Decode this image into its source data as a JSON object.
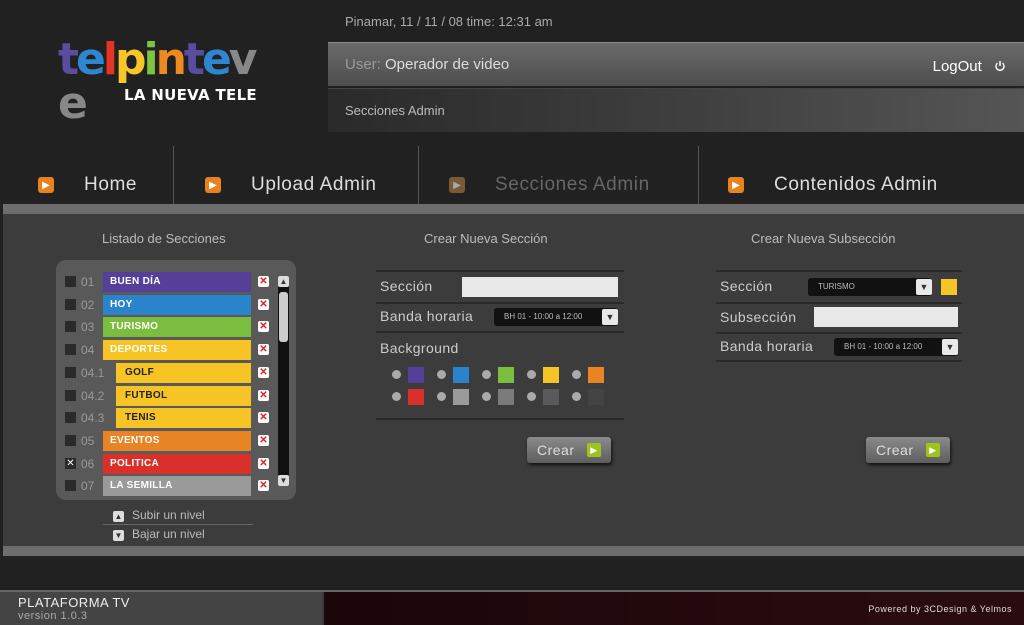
{
  "logo": {
    "word": [
      "t",
      "e",
      "l",
      "p",
      "i",
      "n",
      "t",
      "e",
      "v",
      "e"
    ],
    "colors": [
      "#5a4da0",
      "#2e86d1",
      "#e53422",
      "#f7c628",
      "#7ec342",
      "#ec8b1f",
      "#5a4da0",
      "#2e86d1",
      "#888",
      "#888"
    ],
    "tagline": "LA NUEVA TELE"
  },
  "header": {
    "date_time": "Pinamar, 11 / 11 / 08   time: 12:31 am",
    "user_label": "User:",
    "user_name": "Operador de video",
    "logout": "LogOut",
    "section": "Secciones Admin"
  },
  "nav": [
    {
      "label": "Home",
      "icon": "arrow-right-icon"
    },
    {
      "label": "Upload Admin",
      "icon": "arrow-right-icon"
    },
    {
      "label": "Secciones Admin",
      "icon": "arrow-right-icon",
      "disabled": true
    },
    {
      "label": "Contenidos Admin",
      "icon": "arrow-right-icon"
    }
  ],
  "list": {
    "title": "Listado de Secciones",
    "rows": [
      {
        "num": "01",
        "name": "BUEN DÍA",
        "color": "#553f99",
        "checked": false,
        "sub": false
      },
      {
        "num": "02",
        "name": "HOY",
        "color": "#2a84cc",
        "checked": false,
        "sub": false
      },
      {
        "num": "03",
        "name": "TURISMO",
        "color": "#7bbd3e",
        "checked": false,
        "sub": false
      },
      {
        "num": "04",
        "name": "DEPORTES",
        "color": "#f6c425",
        "checked": false,
        "sub": false
      },
      {
        "num": "04.1",
        "name": "GOLF",
        "color": "#f6c425",
        "checked": false,
        "sub": true,
        "dark": true
      },
      {
        "num": "04.2",
        "name": "FUTBOL",
        "color": "#f6c425",
        "checked": false,
        "sub": true,
        "dark": true
      },
      {
        "num": "04.3",
        "name": "TENIS",
        "color": "#f6c425",
        "checked": false,
        "sub": true,
        "dark": true
      },
      {
        "num": "05",
        "name": "EVENTOS",
        "color": "#e98424",
        "checked": false,
        "sub": false
      },
      {
        "num": "06",
        "name": "POLITICA",
        "color": "#d9302a",
        "checked": true,
        "sub": false
      },
      {
        "num": "07",
        "name": "LA SEMILLA",
        "color": "#9a9a9a",
        "checked": false,
        "sub": false
      }
    ],
    "up_label": "Subir un nivel",
    "down_label": "Bajar un nivel"
  },
  "new_section": {
    "title": "Crear Nueva Sección",
    "section_label": "Sección",
    "section_value": "",
    "band_label": "Banda horaria",
    "band_value": "BH 01 - 10:00 a 12:00",
    "background_label": "Background",
    "swatches": [
      "#553f99",
      "#2a84cc",
      "#7bbd3e",
      "#f6c425",
      "#e98424",
      "#d9302a",
      "#9a9a9a",
      "#7a7a7a",
      "#5a5a5a",
      "#444444"
    ],
    "button": "Crear"
  },
  "new_subsection": {
    "title": "Crear Nueva Subsección",
    "section_label": "Sección",
    "section_value": "TURISMO",
    "section_color": "#f6c425",
    "subsection_label": "Subsección",
    "subsection_value": "",
    "band_label": "Banda horaria",
    "band_value": "BH 01 - 10:00 a 12:00",
    "button": "Crear"
  },
  "footer": {
    "title": "PLATAFORMA TV",
    "version": "version 1.0.3",
    "powered": "Powered by 3CDesign & Yelmos"
  }
}
